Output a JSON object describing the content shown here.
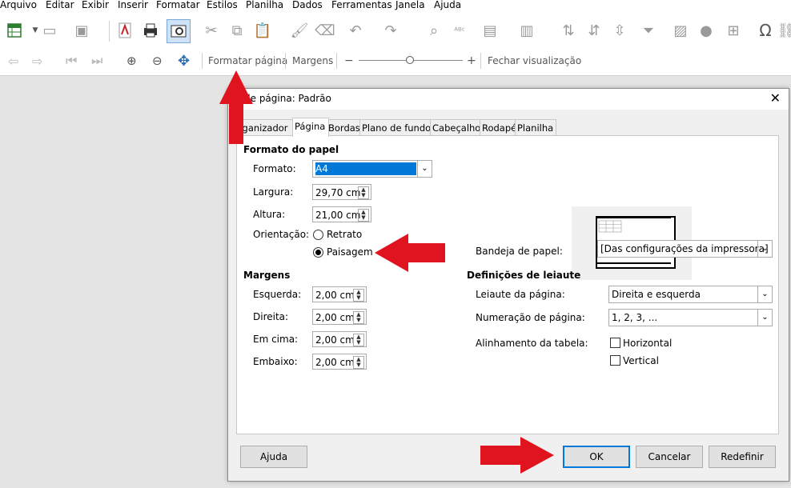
{
  "menubar": [
    "Arquivo",
    "Editar",
    "Exibir",
    "Inserir",
    "Formatar",
    "Estilos",
    "Planilha",
    "Dados",
    "Ferramentas",
    "Janela",
    "Ajuda"
  ],
  "preview_toolbar": {
    "format_page_label": "Formatar página",
    "margins_label": "Margens",
    "zoom_minus": "−",
    "zoom_plus": "+",
    "close_preview_label": "Fechar visualização"
  },
  "dialog": {
    "title": "de página: Padrão",
    "close_glyph": "✕",
    "tabs": [
      "rganizador",
      "Página",
      "Bordas",
      "Plano de fundo",
      "Cabeçalho",
      "Rodapé",
      "Planilha"
    ],
    "paper_format_heading": "Formato do papel",
    "format_label": "Formato:",
    "format_value": "A4",
    "width_label": "Largura:",
    "width_value": "29,70 cm",
    "height_label": "Altura:",
    "height_value": "21,00 cm",
    "orientation_label": "Orientação:",
    "portrait_label": "Retrato",
    "landscape_label": "Paisagem",
    "orientation_selected": "Paisagem",
    "paper_tray_label": "Bandeja de papel:",
    "paper_tray_value": "[Das configurações da impressora]",
    "margins_heading": "Margens",
    "left_label": "Esquerda:",
    "left_value": "2,00 cm",
    "right_label": "Direita:",
    "right_value": "2,00 cm",
    "top_label": "Em cima:",
    "top_value": "2,00 cm",
    "bottom_label": "Embaixo:",
    "bottom_value": "2,00 cm",
    "layout_heading": "Definições de leiaute",
    "page_layout_label": "Leiaute da página:",
    "page_layout_value": "Direita e esquerda",
    "page_numbering_label": "Numeração de página:",
    "page_numbering_value": "1, 2, 3, ...",
    "table_alignment_label": "Alinhamento da tabela:",
    "horizontal_label": "Horizontal",
    "vertical_label": "Vertical",
    "horizontal_checked": false,
    "vertical_checked": false,
    "help_button": "Ajuda",
    "ok_button": "OK",
    "cancel_button": "Cancelar",
    "reset_button": "Redefinir"
  },
  "colors": {
    "annotation_arrow": "#e0141e",
    "selection": "#0078d7",
    "default_button_border": "#0078d7"
  }
}
